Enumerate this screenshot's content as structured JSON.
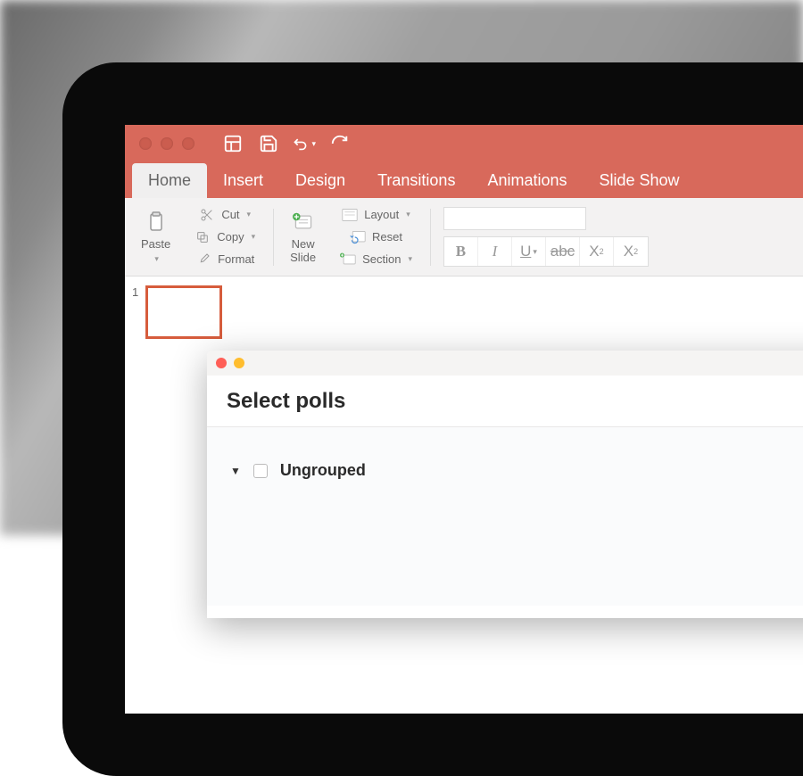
{
  "toolbar_icons": [
    "layout-icon",
    "save-icon",
    "undo-icon",
    "refresh-icon"
  ],
  "tabs": [
    "Home",
    "Insert",
    "Design",
    "Transitions",
    "Animations",
    "Slide Show"
  ],
  "active_tab": "Home",
  "ribbon": {
    "paste": "Paste",
    "cut": "Cut",
    "copy": "Copy",
    "format": "Format",
    "new_slide": "New\nSlide",
    "layout": "Layout",
    "reset": "Reset",
    "section": "Section",
    "bold": "B",
    "italic": "I",
    "underline": "U",
    "strike": "abc",
    "super": "X",
    "sub": "X"
  },
  "thumb_number": "1",
  "modal": {
    "title": "Select polls",
    "group_name": "Ungrouped"
  }
}
